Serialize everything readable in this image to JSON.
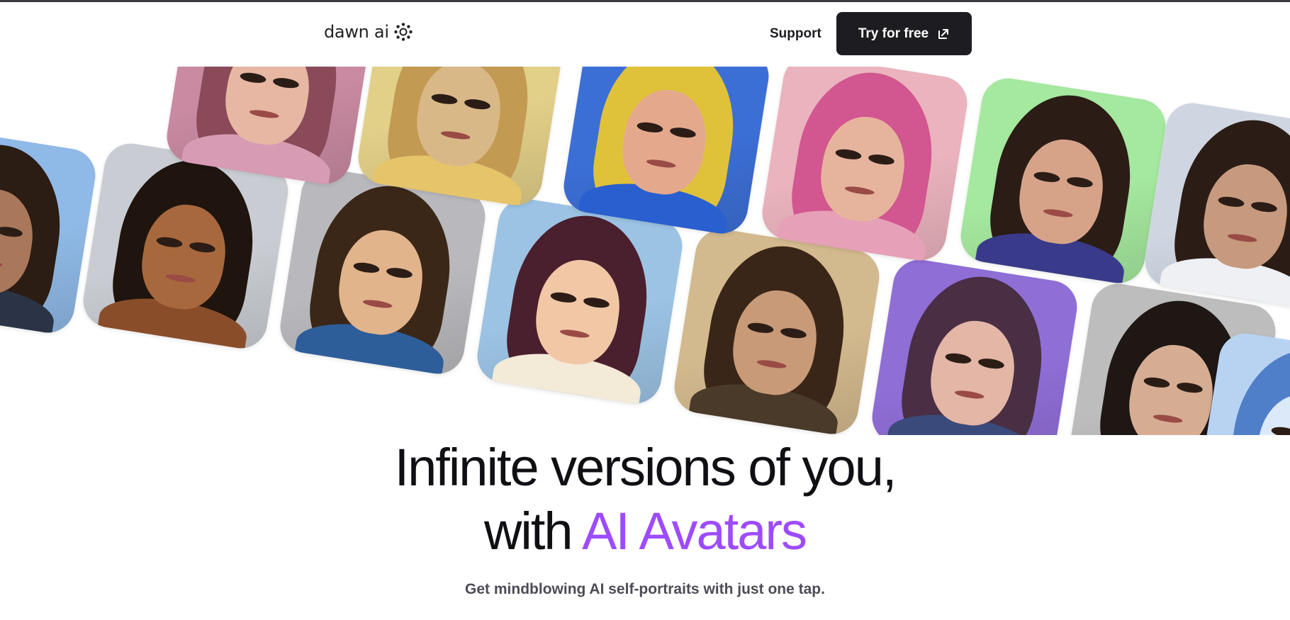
{
  "header": {
    "logo_text": "dawn ai",
    "nav": {
      "support_label": "Support"
    },
    "cta_label": "Try for free"
  },
  "hero": {
    "headline_line1": "Infinite versions of you,",
    "headline_with": "with",
    "headline_accent": "AI Avatars",
    "subtitle": "Get mindblowing AI self-portraits with just one tap."
  },
  "colors": {
    "accent": "#9d4bff",
    "button_bg": "#1d1d21",
    "text_dark": "#101014",
    "subtitle_gray": "#4c4c56"
  },
  "icons": {
    "logo_mark": "sparkle-ring-icon",
    "cta_icon": "external-link-icon"
  },
  "gallery": {
    "avatars": [
      {
        "style": "pixel-art",
        "bg": "#8fb9e6",
        "skin": "#a9785a",
        "hair": "#2b1c14",
        "clothes": "#2a3446"
      },
      {
        "style": "bodybuilder",
        "bg": "#c9cdd3",
        "skin": "#a8683d",
        "hair": "#1f140e",
        "clothes": "#8a4d2a"
      },
      {
        "style": "3d-cartoon",
        "bg": "#b9b9bd",
        "skin": "#e2b48c",
        "hair": "#3b2718",
        "clothes": "#2e5e9a"
      },
      {
        "style": "anime",
        "bg": "#9cc3e4",
        "skin": "#f1c7a6",
        "hair": "#4a1f2e",
        "clothes": "#f3ead8"
      },
      {
        "style": "elf",
        "bg": "#d3b98e",
        "skin": "#c89a78",
        "hair": "#3a2618",
        "clothes": "#4a3a2a"
      },
      {
        "style": "cosmic",
        "bg": "#8f6ed6",
        "skin": "#e3b6a6",
        "hair": "#4a2e44",
        "clothes": "#3a4a7a"
      },
      {
        "style": "realistic-portrait",
        "bg": "#bdbdbd",
        "skin": "#d6ad93",
        "hair": "#1e1714",
        "clothes": "#2a2a2e"
      },
      {
        "style": "fantasy-pink",
        "bg": "#c98aa2",
        "skin": "#e7b7a3",
        "hair": "#8a4a5a",
        "clothes": "#d79bb3"
      },
      {
        "style": "golden",
        "bg": "#e2cf88",
        "skin": "#d9b888",
        "hair": "#c39a52",
        "clothes": "#e6c56a"
      },
      {
        "style": "rainbow-hair",
        "bg": "#3c6fd6",
        "skin": "#e4a98c",
        "hair": "#e0c23a",
        "clothes": "#2a5fd0"
      },
      {
        "style": "pink-watercolor",
        "bg": "#eab3bd",
        "skin": "#e6b49d",
        "hair": "#d2568f",
        "clothes": "#e6a0b8"
      },
      {
        "style": "neon-light",
        "bg": "#a5e89f",
        "skin": "#d6a389",
        "hair": "#2b1c16",
        "clothes": "#3a3a8a"
      },
      {
        "style": "astronaut",
        "bg": "#cfd6e2",
        "skin": "#c79a7f",
        "hair": "#2b1d16",
        "clothes": "#eef0f4"
      },
      {
        "style": "blue-sketch",
        "bg": "#b8d3f2",
        "skin": "#dbe9f8",
        "hair": "#4f7fc9",
        "clothes": "#c9dcf5"
      }
    ]
  }
}
